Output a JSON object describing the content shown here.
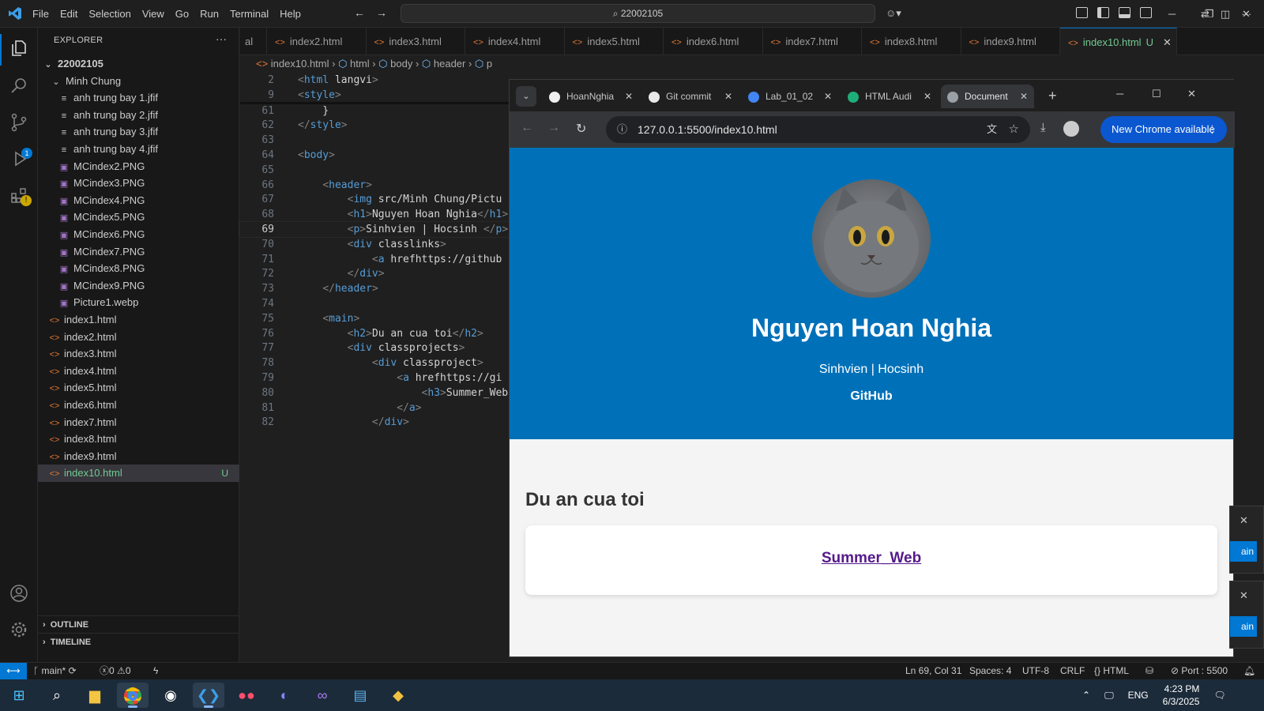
{
  "menu": [
    "File",
    "Edit",
    "Selection",
    "View",
    "Go",
    "Run",
    "Terminal",
    "Help"
  ],
  "command_center": "22002105",
  "explorer": {
    "title": "EXPLORER",
    "root": "22002105",
    "folder": "Minh Chung",
    "folder_files": [
      "anh trung bay 1.jfif",
      "anh trung bay 2.jfif",
      "anh trung bay 3.jfif",
      "anh trung bay 4.jfif",
      "MCindex2.PNG",
      "MCindex3.PNG",
      "MCindex4.PNG",
      "MCindex5.PNG",
      "MCindex6.PNG",
      "MCindex7.PNG",
      "MCindex8.PNG",
      "MCindex9.PNG",
      "Picture1.webp"
    ],
    "root_files": [
      "index1.html",
      "index2.html",
      "index3.html",
      "index4.html",
      "index5.html",
      "index6.html",
      "index7.html",
      "index8.html",
      "index9.html",
      "index10.html"
    ],
    "selected_badge": "U",
    "outline": "OUTLINE",
    "timeline": "TIMELINE"
  },
  "editor_tabs": [
    "al",
    "index2.html",
    "index3.html",
    "index4.html",
    "index5.html",
    "index6.html",
    "index7.html",
    "index8.html",
    "index9.html",
    "index10.html"
  ],
  "active_tab_badge": "U",
  "breadcrumb": [
    "index10.html",
    "html",
    "body",
    "header",
    "p"
  ],
  "code_lines": [
    {
      "n": "2",
      "t": "<html lang=\"vi\">"
    },
    {
      "n": "9",
      "t": "<style>"
    },
    {
      "n": "61",
      "t": "    }"
    },
    {
      "n": "62",
      "t": "</style>"
    },
    {
      "n": "63",
      "t": ""
    },
    {
      "n": "64",
      "t": "<body>"
    },
    {
      "n": "65",
      "t": ""
    },
    {
      "n": "66",
      "t": "    <header>"
    },
    {
      "n": "67",
      "t": "        <img src=\"/Minh Chung/Pictu"
    },
    {
      "n": "68",
      "t": "        <h1>Nguyen Hoan Nghia</h1>"
    },
    {
      "n": "69",
      "t": "        <p>Sinhvien | Hocsinh </p>"
    },
    {
      "n": "70",
      "t": "        <div class=\"links\">"
    },
    {
      "n": "71",
      "t": "            <a href=\"https://github"
    },
    {
      "n": "72",
      "t": "        </div>"
    },
    {
      "n": "73",
      "t": "    </header>"
    },
    {
      "n": "74",
      "t": ""
    },
    {
      "n": "75",
      "t": "    <main>"
    },
    {
      "n": "76",
      "t": "        <h2>Du an cua toi</h2>"
    },
    {
      "n": "77",
      "t": "        <div class=\"projects\">"
    },
    {
      "n": "78",
      "t": "            <div class=\"project\">"
    },
    {
      "n": "79",
      "t": "                <a href=\"https://gi"
    },
    {
      "n": "80",
      "t": "                    <h3>Summer_Web<"
    },
    {
      "n": "81",
      "t": "                </a>"
    },
    {
      "n": "82",
      "t": "            </div>"
    }
  ],
  "current_line": "69",
  "chrome": {
    "tabs": [
      "HoanNghia",
      "Git commit",
      "Lab_01_02",
      "HTML Audi",
      "Document"
    ],
    "url": "127.0.0.1:5500/index10.html",
    "update_button": "New Chrome available"
  },
  "page": {
    "name": "Nguyen Hoan Nghia",
    "subtitle": "Sinhvien | Hocsinh",
    "link": "GitHub",
    "section_title": "Du an cua toi",
    "project": "Summer_Web",
    "header_color": "#0071b9"
  },
  "statusbar": {
    "branch": "main*",
    "errors": "0",
    "warnings": "0",
    "position": "Ln 69, Col 31",
    "spaces": "Spaces: 4",
    "encoding": "UTF-8",
    "eol": "CRLF",
    "language": "HTML",
    "port": "Port : 5500"
  },
  "taskbar": {
    "lang": "ENG",
    "time": "4:23 PM",
    "date": "6/3/2025"
  },
  "notif_buttons": [
    "ain",
    "ain"
  ]
}
